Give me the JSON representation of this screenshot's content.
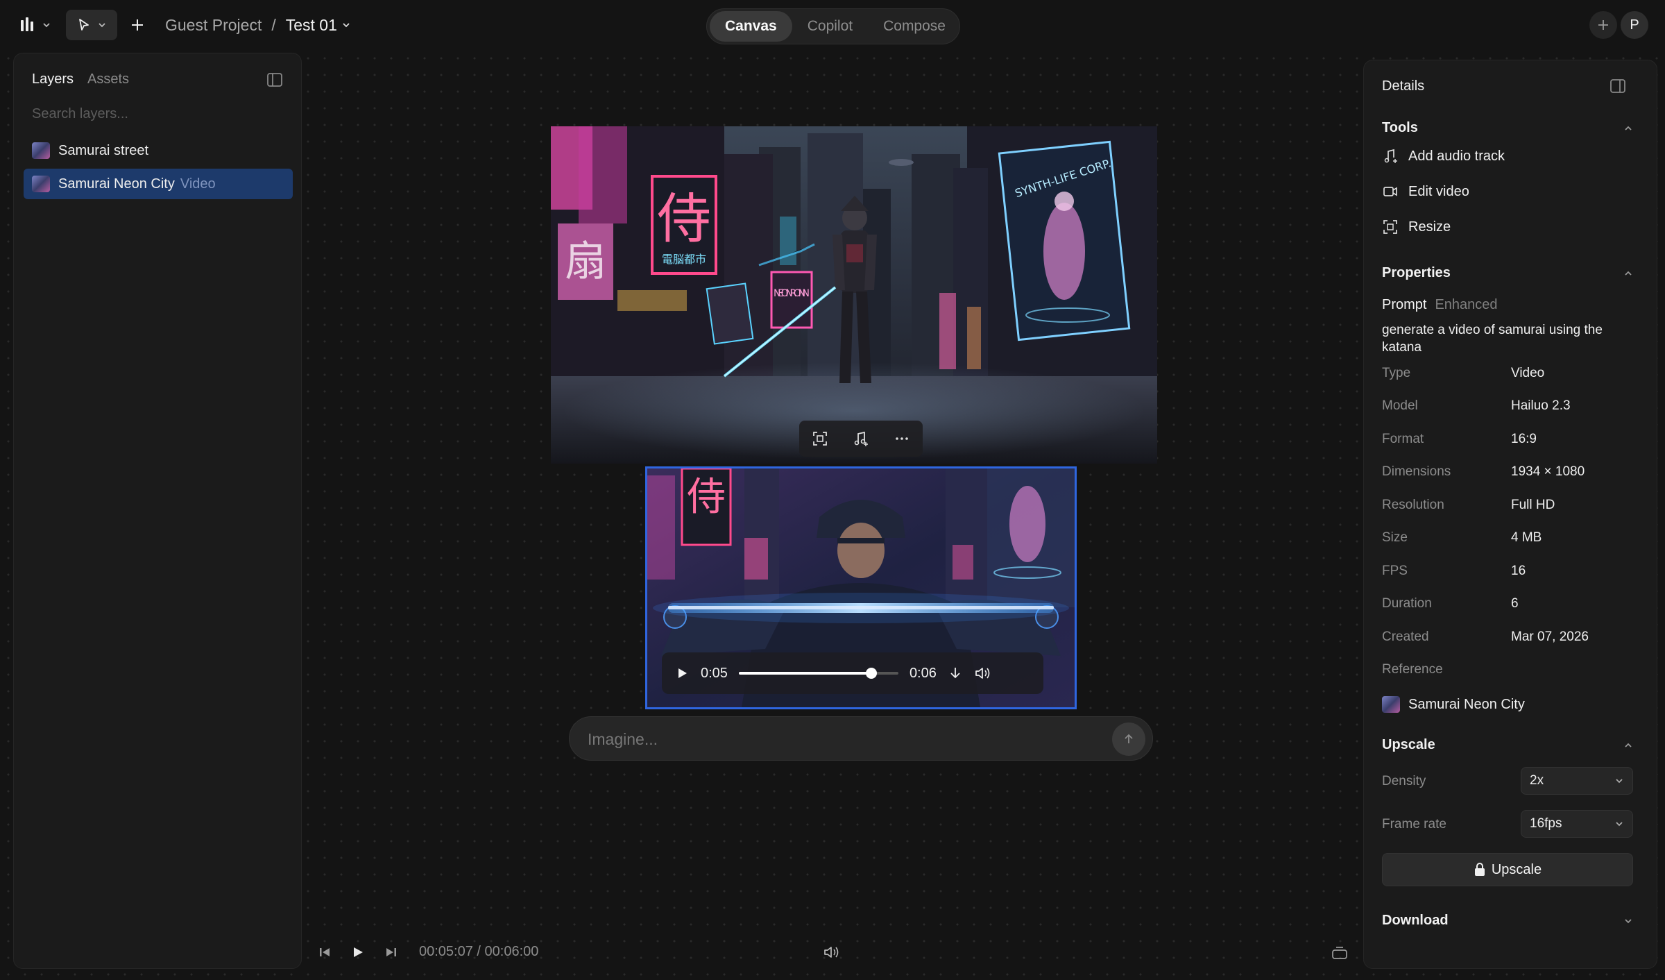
{
  "topbar": {
    "project": "Guest Project",
    "separator": "/",
    "file": "Test 01",
    "tabs": [
      {
        "label": "Canvas",
        "active": true
      },
      {
        "label": "Copilot",
        "active": false
      },
      {
        "label": "Compose",
        "active": false
      }
    ],
    "avatar": "P"
  },
  "layers_panel": {
    "tabs": [
      "Layers",
      "Assets"
    ],
    "search_placeholder": "Search layers...",
    "items": [
      {
        "name": "Samurai street",
        "sub": "",
        "selected": false
      },
      {
        "name": "Samurai Neon City",
        "sub": "Video",
        "selected": true
      }
    ]
  },
  "details": {
    "title": "Details",
    "tools_title": "Tools",
    "tools": [
      "Add audio track",
      "Edit video",
      "Resize"
    ],
    "properties_title": "Properties",
    "prompt_tab": "Prompt",
    "enhanced_tab": "Enhanced",
    "prompt_text": "generate a video of samurai using the katana",
    "props": [
      {
        "k": "Type",
        "v": "Video"
      },
      {
        "k": "Model",
        "v": "Hailuo 2.3"
      },
      {
        "k": "Format",
        "v": "16:9"
      },
      {
        "k": "Dimensions",
        "v": "1934 × 1080"
      },
      {
        "k": "Resolution",
        "v": "Full HD"
      },
      {
        "k": "Size",
        "v": "4 MB"
      },
      {
        "k": "FPS",
        "v": "16"
      },
      {
        "k": "Duration",
        "v": "6"
      },
      {
        "k": "Created",
        "v": "Mar 07, 2026"
      }
    ],
    "reference_label": "Reference",
    "reference_name": "Samurai Neon City",
    "upscale_title": "Upscale",
    "density_label": "Density",
    "density_value": "2x",
    "framerate_label": "Frame rate",
    "framerate_value": "16fps",
    "upscale_button": "Upscale",
    "download_title": "Download"
  },
  "player": {
    "current": "0:05",
    "total": "0:06",
    "progress": 0.83
  },
  "prompt_bar": {
    "placeholder": "Imagine..."
  },
  "timeline": {
    "timecode": "00:05:07 / 00:06:00"
  },
  "canvas_art": {
    "sign_kanji": "侍",
    "sign_sub": "電脳都市",
    "sign_neon": "NEON RONIN",
    "sign_synth": "SYNTH-LIFE CORP."
  },
  "colors": {
    "accent": "#2f66e0",
    "selection": "#1d3a6b",
    "background": "#141414",
    "panel": "#1b1b1b"
  }
}
